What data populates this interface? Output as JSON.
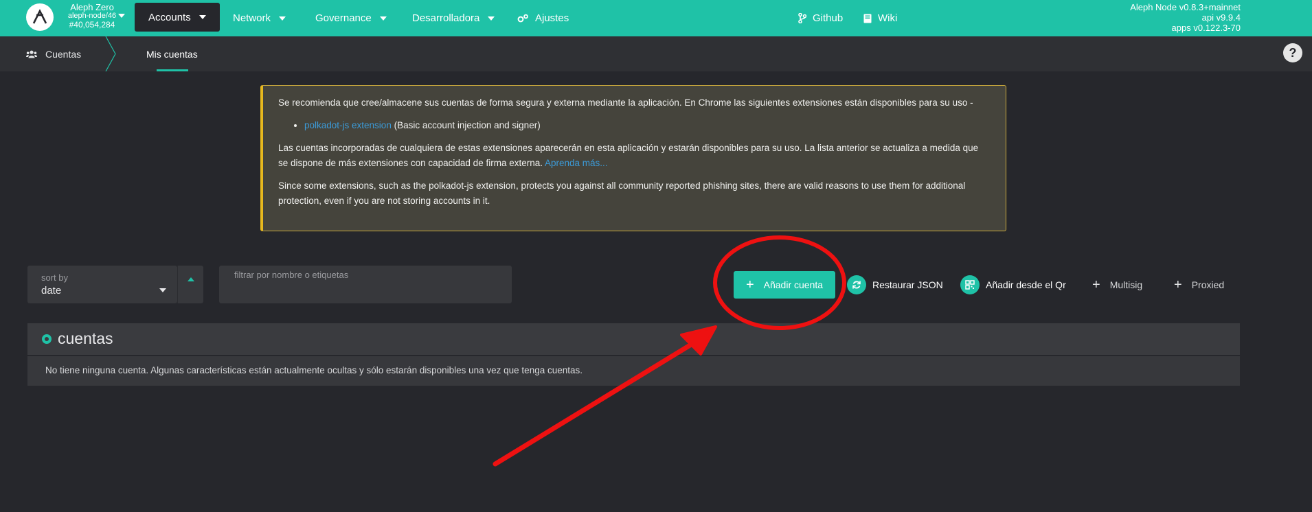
{
  "chain": {
    "name": "Aleph Zero",
    "node": "aleph-node/46",
    "block": "#40,054,284"
  },
  "nav": {
    "accounts": "Accounts",
    "network": "Network",
    "governance": "Governance",
    "developer": "Desarrolladora",
    "settings": "Ajustes",
    "github": "Github",
    "wiki": "Wiki"
  },
  "versions": {
    "node": "Aleph Node v0.8.3+mainnet",
    "api": "api v9.9.4",
    "apps": "apps v0.122.3-70"
  },
  "breadcrumb": {
    "root": "Cuentas",
    "tab": "Mis cuentas"
  },
  "help": {
    "label": "?"
  },
  "info": {
    "p1": "Se recomienda que cree/almacene sus cuentas de forma segura y externa mediante la aplicación. En Chrome las siguientes extensiones están disponibles para su uso -",
    "ext_link": "polkadot-js extension",
    "ext_desc": " (Basic account injection and signer)",
    "p2": "Las cuentas incorporadas de cualquiera de estas extensiones aparecerán en esta aplicación y estarán disponibles para su uso. La lista anterior se actualiza a medida que se dispone de más extensiones con capacidad de firma externa. ",
    "learn_more": "Aprenda más...",
    "p3": "Since some extensions, such as the polkadot-js extension, protects you against all community reported phishing sites, there are valid reasons to use them for additional protection, even if you are not storing accounts in it."
  },
  "sort": {
    "label": "sort by",
    "value": "date"
  },
  "filter": {
    "placeholder": "filtrar por nombre o etiquetas"
  },
  "actions": {
    "add": "Añadir cuenta",
    "restore": "Restaurar JSON",
    "qr": "Añadir desde el Qr",
    "multisig": "Multisig",
    "proxied": "Proxied"
  },
  "accounts": {
    "title": "cuentas",
    "empty": "No tiene ninguna cuenta. Algunas características están actualmente ocultas y sólo estarán disponibles una vez que tenga cuentas."
  },
  "colors": {
    "accent": "#1fc2a7",
    "background": "#26272c",
    "annotation": "#ee1111"
  }
}
